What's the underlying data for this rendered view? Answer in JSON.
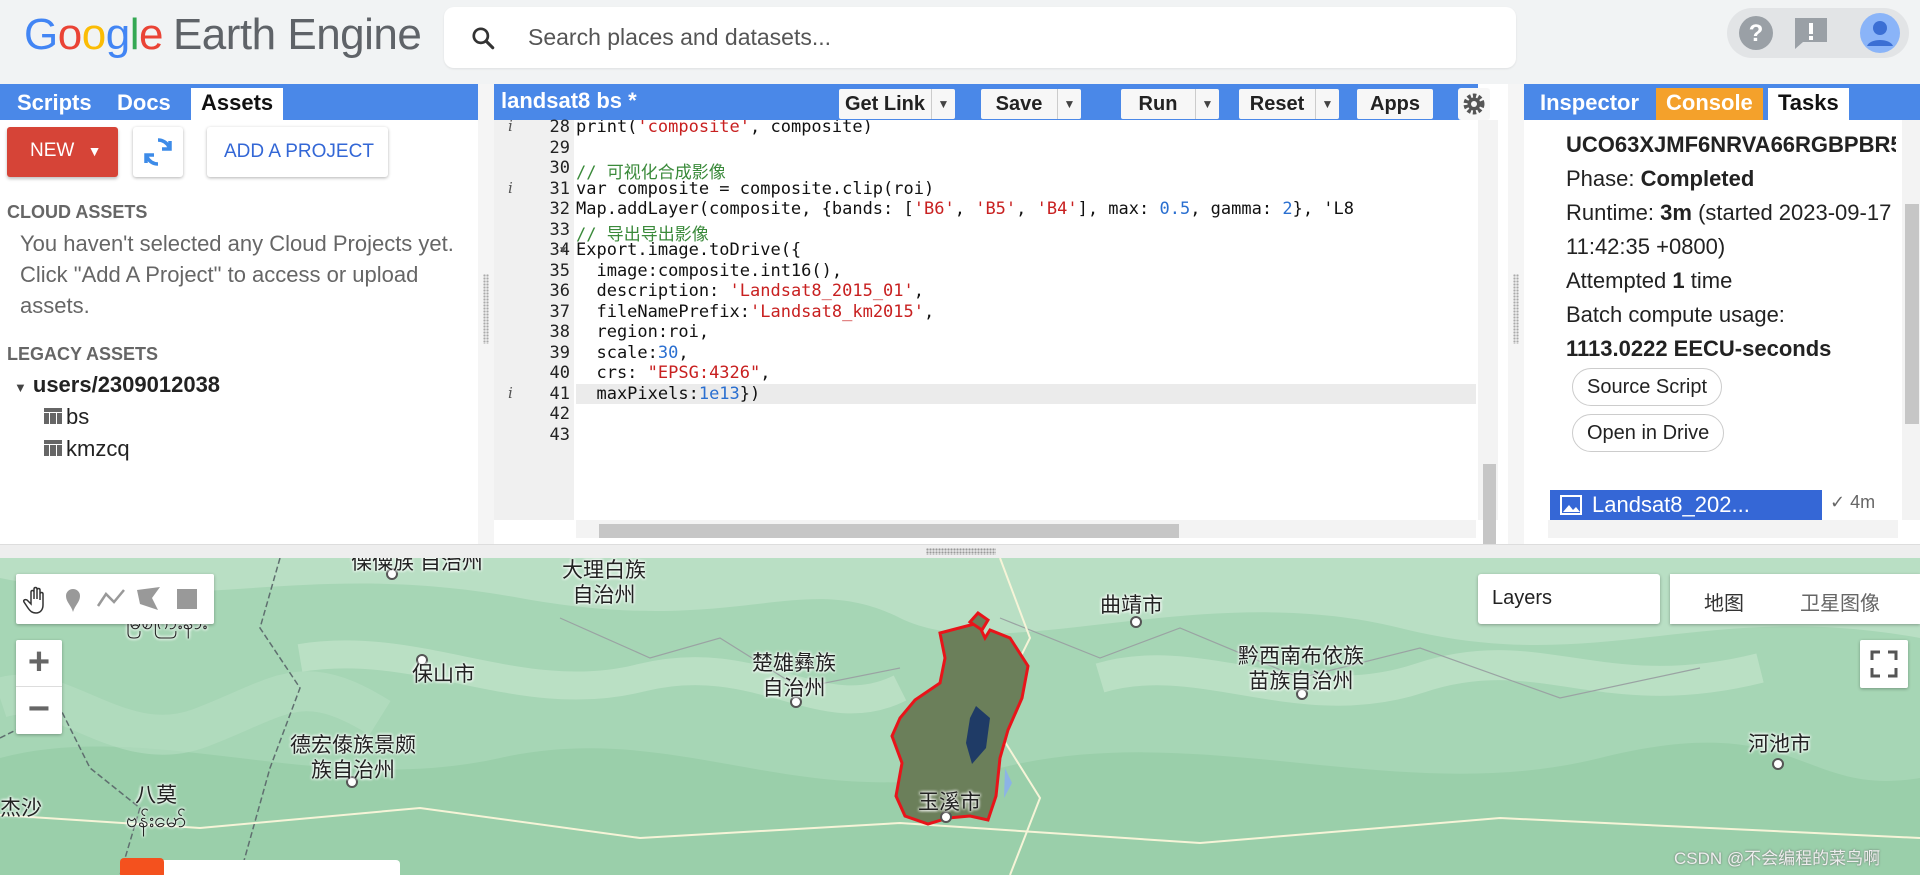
{
  "header": {
    "logo_google": "Google",
    "logo_product": "Earth Engine",
    "search_placeholder": "Search places and datasets..."
  },
  "left_panel": {
    "tabs": [
      "Scripts",
      "Docs",
      "Assets"
    ],
    "active_tab": "Assets",
    "new_button": "NEW",
    "add_project_button": "ADD A PROJECT",
    "cloud_heading": "CLOUD ASSETS",
    "cloud_message": "You haven't selected any Cloud Projects yet. Click \"Add A Project\" to access or upload assets.",
    "legacy_heading": "LEGACY ASSETS",
    "user_root": "users/2309012038",
    "assets": [
      "bs",
      "kmzcq"
    ]
  },
  "editor": {
    "file_title": "landsat8 bs *",
    "buttons": {
      "get_link": "Get Link",
      "save": "Save",
      "run": "Run",
      "reset": "Reset",
      "apps": "Apps"
    },
    "line_numbers": [
      "28",
      "29",
      "30",
      "31",
      "32",
      "33",
      "34",
      "35",
      "36",
      "37",
      "38",
      "39",
      "40",
      "41",
      "42",
      "43"
    ],
    "info_lines": [
      "28",
      "31",
      "41"
    ],
    "fold_line": "34",
    "active_line": "41",
    "code_lines": [
      "print('composite', composite)",
      "",
      "// 可视化合成影像",
      "var composite = composite.clip(roi)",
      "Map.addLayer(composite, {bands: ['B6', 'B5', 'B4'], max: 0.5, gamma: 2}, 'L8",
      "// 导出导出影像",
      "Export.image.toDrive({",
      "  image:composite.int16(),",
      "  description: 'Landsat8_2015_01',",
      "  fileNamePrefix:'Landsat8_km2015',",
      "  region:roi,",
      "  scale:30,",
      "  crs: \"EPSG:4326\",",
      "  maxPixels:1e13})",
      "",
      ""
    ]
  },
  "right_panel": {
    "tabs": [
      "Inspector",
      "Console",
      "Tasks"
    ],
    "active_tab": "Tasks",
    "task": {
      "id": "UCO63XJMF6NRVA66RGBPBR5",
      "phase_label": "Phase:",
      "phase_value": "Completed",
      "runtime_label": "Runtime:",
      "runtime_value": "3m",
      "runtime_detail": "(started 2023-09-17 11:42:35 +0800)",
      "attempted_label": "Attempted",
      "attempted_value": "1",
      "attempted_suffix": "time",
      "usage_label": "Batch compute usage:",
      "usage_value": "1113.0222 EECU-seconds",
      "source_script_button": "Source Script",
      "open_drive_button": "Open in Drive",
      "item_name": "Landsat8_202...",
      "item_status": "4m"
    }
  },
  "map": {
    "layers_label": "Layers",
    "map_types": [
      "地图",
      "卫星图像"
    ],
    "places": [
      {
        "name": "保山市"
      },
      {
        "name": "大理白族\n自治州"
      },
      {
        "name": "楚雄彝族\n自治州"
      },
      {
        "name": "曲靖市"
      },
      {
        "name": "黔西南布依族\n苗族自治州"
      },
      {
        "name": "德宏傣族景颇\n族自治州"
      },
      {
        "name": "八莫\nဗန်းမော်"
      },
      {
        "name": "河池市"
      },
      {
        "name": "玉溪市"
      },
      {
        "name": "傈僳族\n自治州"
      },
      {
        "name": "မြစ်ကြီးနား"
      },
      {
        "name": "杰沙"
      }
    ],
    "watermark": "CSDN @不会编程的菜鸟啊"
  },
  "colors": {
    "tab_blue": "#4a88e8",
    "new_red": "#d64437",
    "console_orange": "#f4a12b",
    "task_blue": "#3567d6",
    "roi_outline": "#e8141a"
  }
}
